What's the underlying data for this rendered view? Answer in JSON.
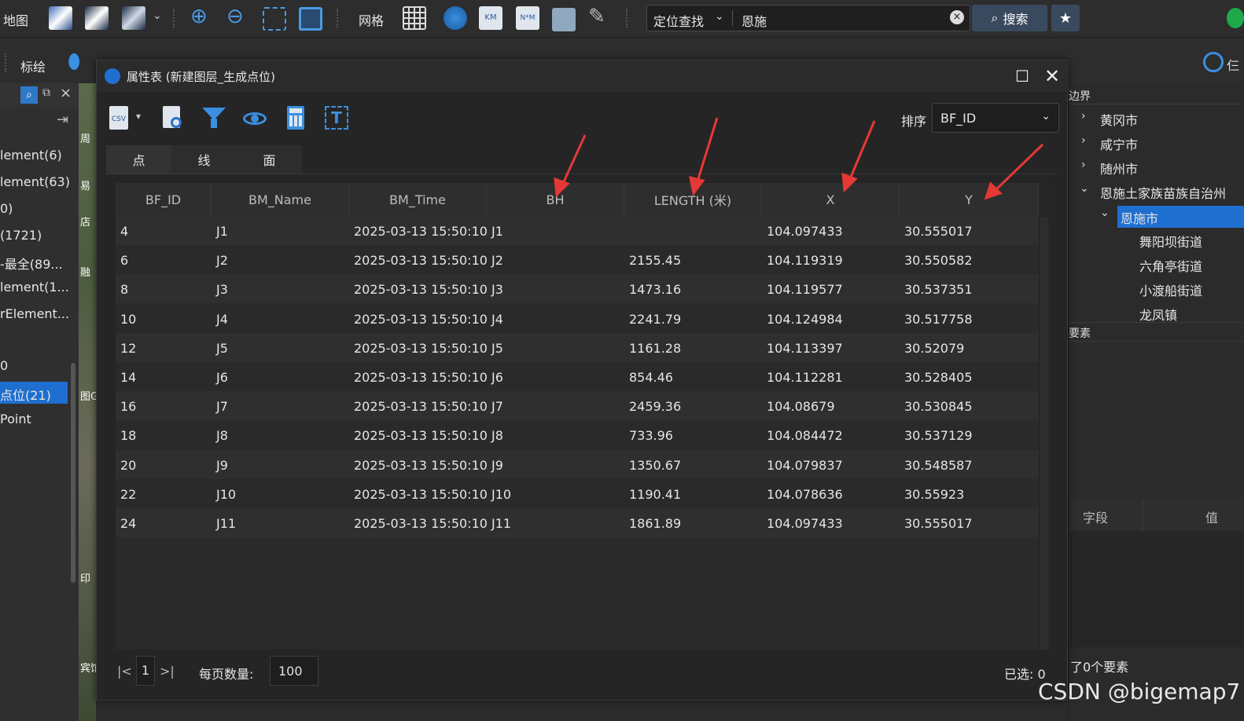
{
  "toolbar": {
    "map_label": "地图",
    "grid_label": "网格",
    "locate_label": "定位查找",
    "search_value": "恩施",
    "search_button": "搜索",
    "annotate_label": "标绘"
  },
  "left_panel": {
    "items": [
      "lement(6)",
      "lement(63)",
      "0)",
      "(1721)",
      "-最全(89...",
      "lement(1...",
      "rElement...",
      "0",
      "点位(21)",
      "Point"
    ]
  },
  "map_strip": {
    "labels": [
      "周",
      "易",
      "店",
      "融",
      "图G",
      "印",
      "宾馆"
    ]
  },
  "right_panel": {
    "boundary_title": "边界",
    "tree": [
      "黄冈市",
      "咸宁市",
      "随州市",
      "恩施土家族苗族自治州",
      "恩施市",
      "舞阳坝街道",
      "六角亭街道",
      "小渡船街道",
      "龙凤镇"
    ],
    "features_title": "要素",
    "field_header": "字段",
    "value_header": "值",
    "status_text": "了0个要素"
  },
  "dialog": {
    "title": "属性表 (新建图层_生成点位)",
    "sort_label": "排序",
    "sort_value": "BF_ID",
    "tabs": [
      "点",
      "线",
      "面"
    ],
    "columns": [
      "BF_ID",
      "BM_Name",
      "BM_Time",
      "BH",
      "LENGTH (米)",
      "X",
      "Y"
    ],
    "rows": [
      [
        "4",
        "J1",
        "2025-03-13 15:50:10",
        "J1",
        "",
        "104.097433",
        "30.555017"
      ],
      [
        "6",
        "J2",
        "2025-03-13 15:50:10",
        "J2",
        "2155.45",
        "104.119319",
        "30.550582"
      ],
      [
        "8",
        "J3",
        "2025-03-13 15:50:10",
        "J3",
        "1473.16",
        "104.119577",
        "30.537351"
      ],
      [
        "10",
        "J4",
        "2025-03-13 15:50:10",
        "J4",
        "2241.79",
        "104.124984",
        "30.517758"
      ],
      [
        "12",
        "J5",
        "2025-03-13 15:50:10",
        "J5",
        "1161.28",
        "104.113397",
        "30.52079"
      ],
      [
        "14",
        "J6",
        "2025-03-13 15:50:10",
        "J6",
        "854.46",
        "104.112281",
        "30.528405"
      ],
      [
        "16",
        "J7",
        "2025-03-13 15:50:10",
        "J7",
        "2459.36",
        "104.08679",
        "30.530845"
      ],
      [
        "18",
        "J8",
        "2025-03-13 15:50:10",
        "J8",
        "733.96",
        "104.084472",
        "30.537129"
      ],
      [
        "20",
        "J9",
        "2025-03-13 15:50:10",
        "J9",
        "1350.67",
        "104.079837",
        "30.548587"
      ],
      [
        "22",
        "J10",
        "2025-03-13 15:50:10",
        "J10",
        "1190.41",
        "104.078636",
        "30.55923"
      ],
      [
        "24",
        "J11",
        "2025-03-13 15:50:10",
        "J11",
        "1861.89",
        "104.097433",
        "30.555017"
      ]
    ],
    "page_number": "1",
    "page_size_label": "每页数量:",
    "page_size_value": "100",
    "selected_text": "已选: 0"
  },
  "watermark": "CSDN @bigemap7",
  "colors": {
    "accent": "#1e6fd0",
    "arrow": "#e53935"
  }
}
